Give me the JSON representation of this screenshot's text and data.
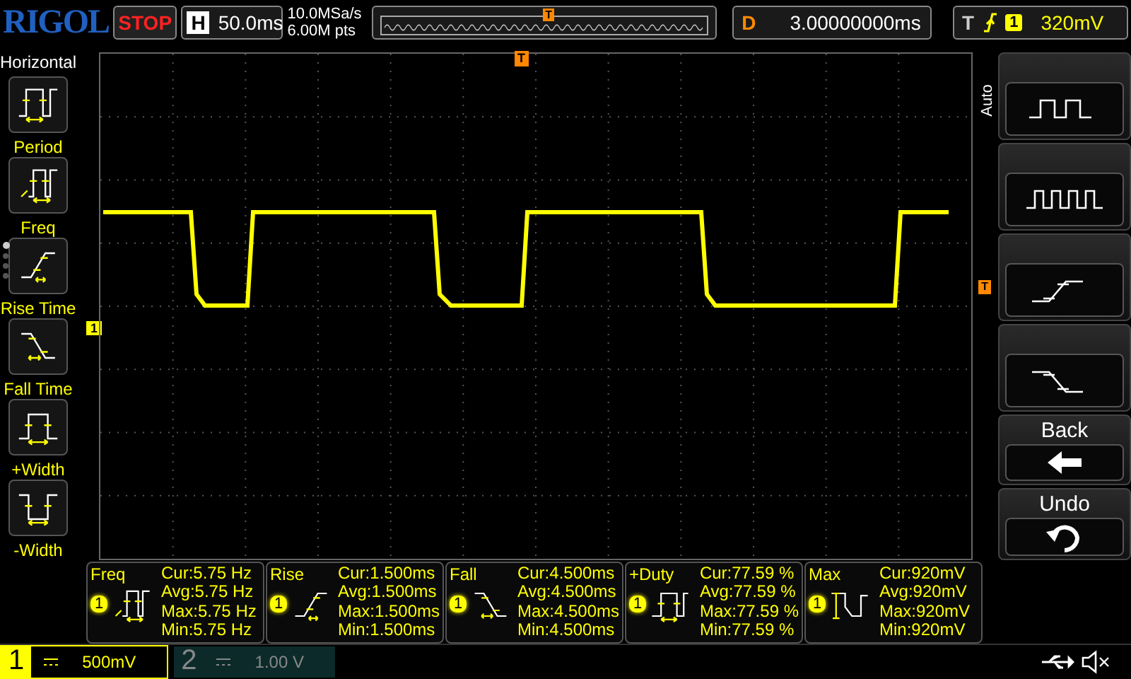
{
  "top_bar": {
    "logo": "RIGOL",
    "run_state": "STOP",
    "timebase_label": "H",
    "timebase": "50.0ms",
    "sample_rate": "10.0MSa/s",
    "memory_depth": "6.00M pts",
    "trigger_position_marker": "T",
    "delay_label": "D",
    "delay": "3.00000000ms",
    "trigger_label": "T",
    "trigger_source": "1",
    "trigger_level": "320mV"
  },
  "left_menu": {
    "title": "Horizontal",
    "items": [
      {
        "kind": "period",
        "label": "Period"
      },
      {
        "kind": "freq",
        "label": "Freq"
      },
      {
        "kind": "rise",
        "label": "Rise Time"
      },
      {
        "kind": "fall",
        "label": "Fall Time"
      },
      {
        "kind": "pwidth",
        "label": "+Width"
      },
      {
        "kind": "nwidth",
        "label": "-Width"
      }
    ],
    "pages": [
      {
        "selected": true
      },
      {
        "selected": false
      },
      {
        "selected": false
      },
      {
        "selected": false
      }
    ]
  },
  "screen": {
    "trigger_marker": "T",
    "level_marker": "T",
    "channel_marker": "1"
  },
  "right_menu": {
    "tab": "Auto",
    "buttons": [
      {
        "kind": "square-slow"
      },
      {
        "kind": "square-fast"
      },
      {
        "kind": "rise"
      },
      {
        "kind": "fall"
      },
      {
        "kind": "back",
        "label": "Back"
      },
      {
        "kind": "undo",
        "label": "Undo"
      }
    ]
  },
  "measurements": [
    {
      "kind": "freq",
      "name": "Freq",
      "channel": "1",
      "cur": "Cur:5.75 Hz",
      "avg": "Avg:5.75 Hz",
      "max": "Max:5.75 Hz",
      "min": "Min:5.75 Hz"
    },
    {
      "kind": "rise",
      "name": "Rise",
      "channel": "1",
      "cur": "Cur:1.500ms",
      "avg": "Avg:1.500ms",
      "max": "Max:1.500ms",
      "min": "Min:1.500ms"
    },
    {
      "kind": "fall",
      "name": "Fall",
      "channel": "1",
      "cur": "Cur:4.500ms",
      "avg": "Avg:4.500ms",
      "max": "Max:4.500ms",
      "min": "Min:4.500ms"
    },
    {
      "kind": "duty",
      "name": "+Duty",
      "channel": "1",
      "cur": "Cur:77.59 %",
      "avg": "Avg:77.59 %",
      "max": "Max:77.59 %",
      "min": "Min:77.59 %"
    },
    {
      "kind": "max",
      "name": "Max",
      "channel": "1",
      "cur": "Cur:920mV",
      "avg": "Avg:920mV",
      "max": "Max:920mV",
      "min": "Min:920mV"
    }
  ],
  "channels": [
    {
      "number": "1",
      "scale": "500mV",
      "active": true
    },
    {
      "number": "2",
      "scale": "1.00 V",
      "active": false
    }
  ]
}
